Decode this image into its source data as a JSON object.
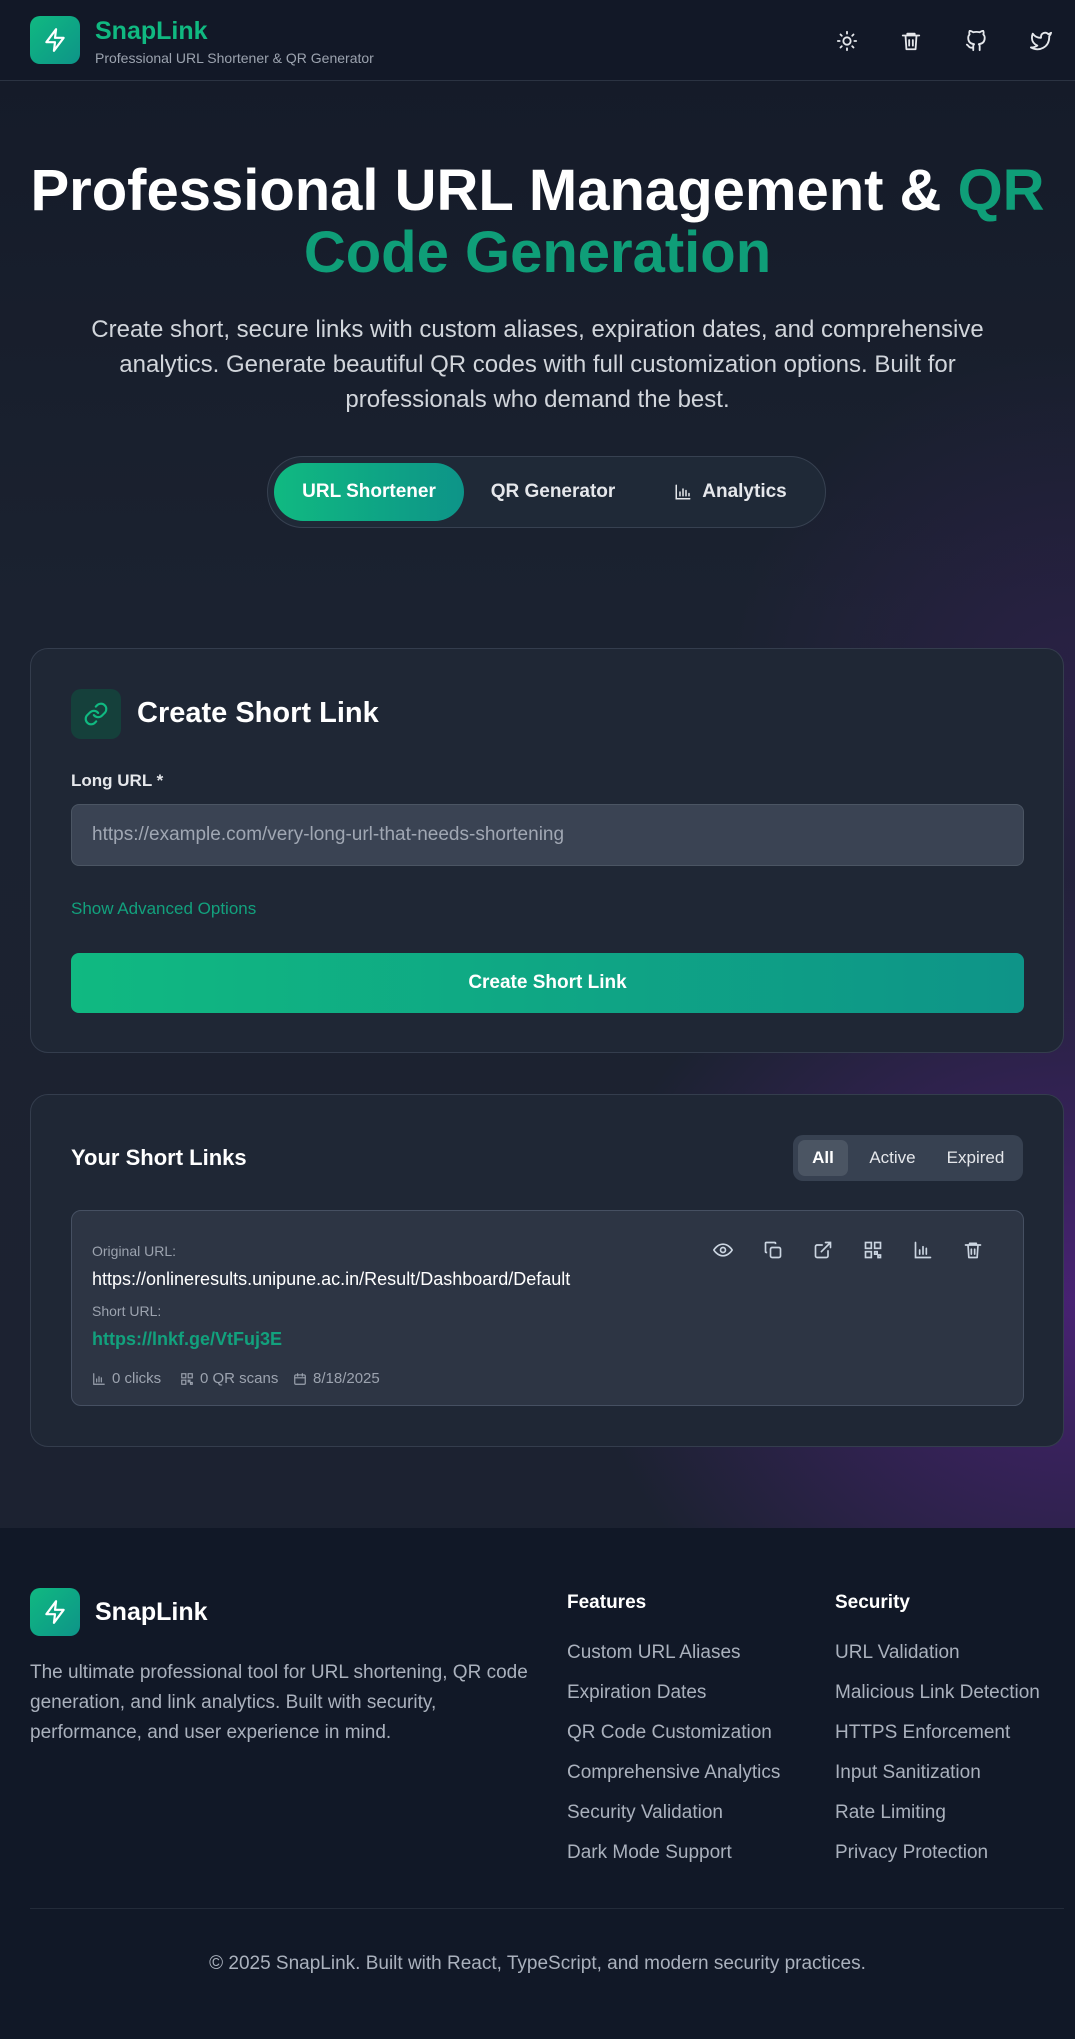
{
  "header": {
    "brand": "SnapLink",
    "tagline": "Professional URL Shortener & QR Generator",
    "icons": [
      "sun-icon",
      "trash-icon",
      "github-icon",
      "twitter-icon"
    ]
  },
  "hero": {
    "title_main": "Professional URL Management & ",
    "title_accent": "QR Code Generation",
    "subtitle": "Create short, secure links with custom aliases, expiration dates, and comprehensive analytics. Generate beautiful QR codes with full customization options. Built for professionals who demand the best.",
    "tabs": [
      {
        "label": "URL Shortener",
        "active": true
      },
      {
        "label": "QR Generator",
        "active": false
      },
      {
        "label": "Analytics",
        "active": false
      }
    ]
  },
  "create": {
    "title": "Create Short Link",
    "url_label": "Long URL *",
    "url_placeholder": "https://example.com/very-long-url-that-needs-shortening",
    "url_value": "",
    "advanced_link": "Show Advanced Options",
    "submit_label": "Create Short Link"
  },
  "links": {
    "title": "Your Short Links",
    "filters": [
      {
        "label": "All",
        "active": true
      },
      {
        "label": "Active",
        "active": false
      },
      {
        "label": "Expired",
        "active": false
      }
    ],
    "items": [
      {
        "original_label": "Original URL:",
        "original_url": "https://onlineresults.unipune.ac.in/Result/Dashboard/Default",
        "short_label": "Short URL:",
        "short_url": "https://lnkf.ge/VtFuj3E",
        "clicks": "0 clicks",
        "qr_scans": "0 QR scans",
        "date": "8/18/2025"
      }
    ]
  },
  "footer": {
    "brand": "SnapLink",
    "description": "The ultimate professional tool for URL shortening, QR code generation, and link analytics. Built with security, performance, and user experience in mind.",
    "features_title": "Features",
    "features": [
      "Custom URL Aliases",
      "Expiration Dates",
      "QR Code Customization",
      "Comprehensive Analytics",
      "Security Validation",
      "Dark Mode Support"
    ],
    "security_title": "Security",
    "security": [
      "URL Validation",
      "Malicious Link Detection",
      "HTTPS Enforcement",
      "Input Sanitization",
      "Rate Limiting",
      "Privacy Protection"
    ],
    "copyright": "© 2025 SnapLink. Built with React, TypeScript, and modern security practices."
  },
  "colors": {
    "accent": "#10b981",
    "accent_dark": "#0d9488",
    "background": "#111827",
    "card": "#1f2735"
  }
}
